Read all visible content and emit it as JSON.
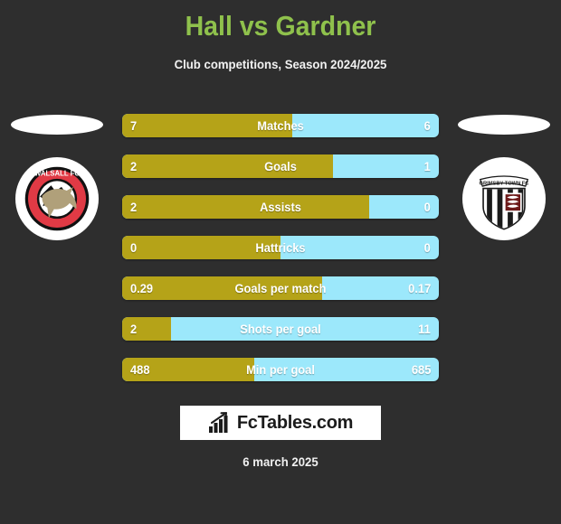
{
  "header": {
    "title": "Hall vs Gardner",
    "subtitle": "Club competitions, Season 2024/2025",
    "title_color": "#8fc14c"
  },
  "teams": {
    "home": {
      "name": "Walsall FC",
      "crest_text": "WALSALL FC",
      "crest_colors": {
        "primary": "#e03a45",
        "secondary": "#b0a07a",
        "outline": "#111111"
      }
    },
    "away": {
      "name": "Grimsby Town FC",
      "crest_text": "GRIMSBY TOWN FC",
      "crest_colors": {
        "primary": "#1a1a1a",
        "secondary": "#ffffff",
        "accent": "#6e1b1b"
      }
    }
  },
  "colors": {
    "background": "#2e2e2e",
    "home_bar": "#b5a318",
    "away_bar": "#9ce8fb",
    "value_text": "#ffffff"
  },
  "chart_data": {
    "type": "bar",
    "title": "Hall vs Gardner",
    "subtitle": "Club competitions, Season 2024/2025",
    "orientation": "horizontal-diverging",
    "categories": [
      "Matches",
      "Goals",
      "Assists",
      "Hattricks",
      "Goals per match",
      "Shots per goal",
      "Min per goal"
    ],
    "series": [
      {
        "name": "Hall",
        "color": "#b5a318",
        "values": [
          7,
          2,
          2,
          0,
          0.29,
          2,
          488
        ]
      },
      {
        "name": "Gardner",
        "color": "#9ce8fb",
        "values": [
          6,
          1,
          0,
          0,
          0.17,
          11,
          685
        ]
      }
    ],
    "legend": "none",
    "grid": false
  },
  "rows": [
    {
      "label": "Matches",
      "left": "7",
      "right": "6",
      "fill_pct": 53.8
    },
    {
      "label": "Goals",
      "left": "2",
      "right": "1",
      "fill_pct": 66.7
    },
    {
      "label": "Assists",
      "left": "2",
      "right": "0",
      "fill_pct": 78.0
    },
    {
      "label": "Hattricks",
      "left": "0",
      "right": "0",
      "fill_pct": 50.0
    },
    {
      "label": "Goals per match",
      "left": "0.29",
      "right": "0.17",
      "fill_pct": 63.0
    },
    {
      "label": "Shots per goal",
      "left": "2",
      "right": "11",
      "fill_pct": 15.4
    },
    {
      "label": "Min per goal",
      "left": "488",
      "right": "685",
      "fill_pct": 41.6
    }
  ],
  "footer": {
    "brand": "FcTables.com",
    "brand_icon": "bar-chart-arrow-icon",
    "date": "6 march 2025"
  }
}
